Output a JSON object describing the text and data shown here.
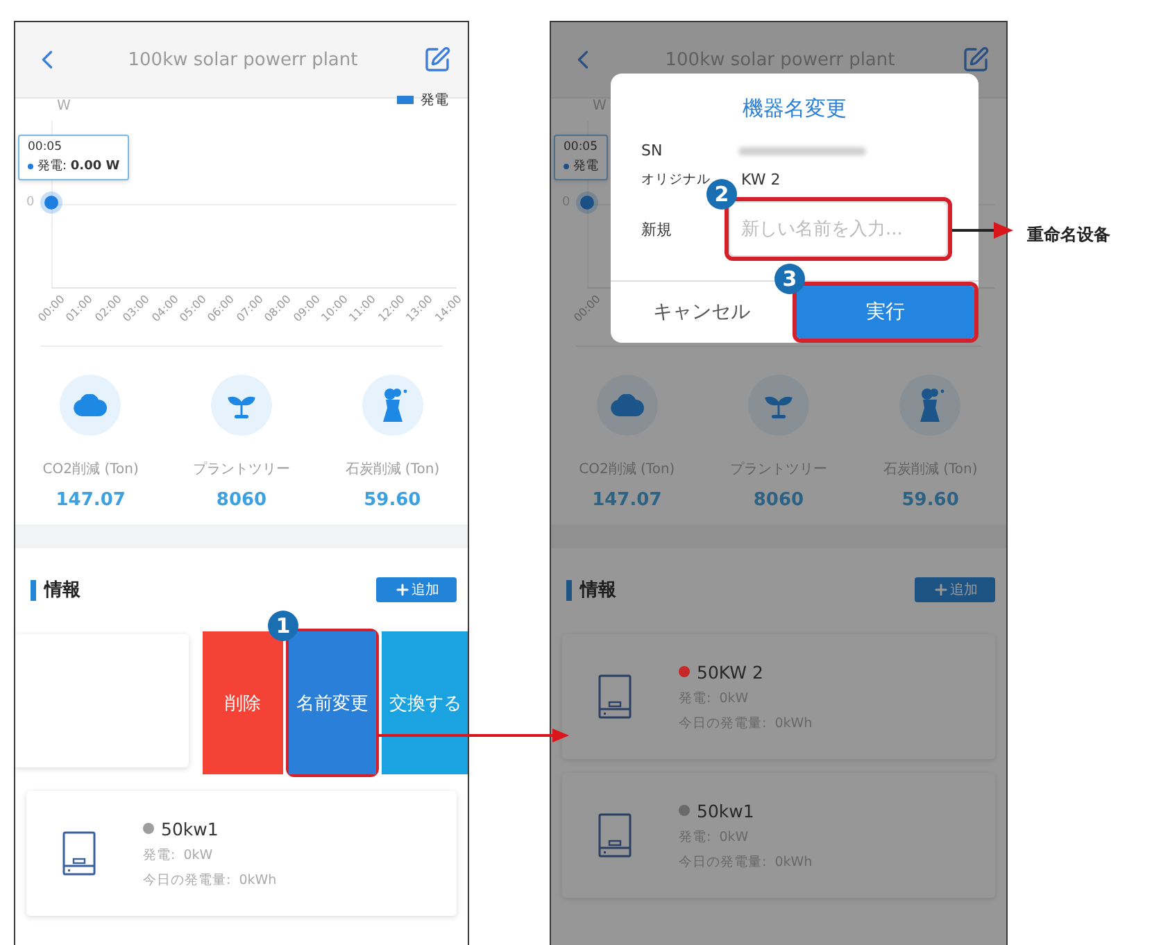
{
  "annotations": {
    "callout": "重命名设备"
  },
  "screens": [
    {
      "dimmed": false,
      "title": "100kw solar powerr plant",
      "chart": {
        "legend": "発電",
        "unit": "W",
        "tooltip": {
          "time": "00:05",
          "text": "発電: **0.00 W**"
        },
        "y_tick": "0",
        "x_ticks": [
          "00:00",
          "01:00",
          "02:00",
          "03:00",
          "04:00",
          "05:00",
          "06:00",
          "07:00",
          "08:00",
          "09:00",
          "10:00",
          "11:00",
          "12:00",
          "13:00",
          "14:00"
        ]
      },
      "stats": [
        {
          "kind": "co2",
          "label": "CO2削減 (Ton)",
          "value": "147.07"
        },
        {
          "kind": "plant",
          "label": "プラントツリー",
          "value": "8060"
        },
        {
          "kind": "tower",
          "label": "石炭削減 (Ton)",
          "value": "59.60"
        }
      ],
      "section": {
        "title": "情報",
        "add_button": "追加"
      },
      "devices": [
        {
          "kind": "swiped",
          "actions": [
            {
              "kind": "delete",
              "label": "削除",
              "highlighted": false
            },
            {
              "kind": "rename",
              "label": "名前変更",
              "highlighted": true,
              "step": "1"
            },
            {
              "kind": "replace",
              "label": "交換する",
              "highlighted": false
            }
          ]
        },
        {
          "kind": "card",
          "name": "50kw1",
          "color": "#9e9e9e",
          "power": "発電:  0kW",
          "energy": "今日の発電量:  0kWh"
        }
      ]
    },
    {
      "dimmed": true,
      "title": "100kw solar powerr plant",
      "chart": {
        "unit": "W",
        "tooltip": {
          "time": "00:05",
          "text": "発電"
        },
        "y_tick": "0",
        "x_ticks": [
          "00:00"
        ]
      },
      "stats": [
        {
          "kind": "co2",
          "label": "CO2削減 (Ton)",
          "value": "147.07"
        },
        {
          "kind": "plant",
          "label": "プラントツリー",
          "value": "8060"
        },
        {
          "kind": "tower",
          "label": "石炭削減 (Ton)",
          "value": "59.60"
        }
      ],
      "section": {
        "title": "情報",
        "add_button": "追加"
      },
      "devices": [
        {
          "kind": "card",
          "name": "50KW 2",
          "color": "#c62828",
          "power": "発電:  0kW",
          "energy": "今日の発電量:  0kWh"
        },
        {
          "kind": "card",
          "name": "50kw1",
          "color": "#6a6a6a",
          "power": "発電:  0kW",
          "energy": "今日の発電量:  0kWh"
        }
      ],
      "dialog": {
        "title": "機器名変更",
        "sn_label": "SN",
        "original_label": "オリジナル",
        "original_value": "KW 2",
        "new_label": "新規",
        "input": {
          "placeholder": "新しい名前を入力...",
          "highlighted": true,
          "step": "2"
        },
        "cancel": "キャンセル",
        "confirm": {
          "label": "実行",
          "highlighted": true,
          "step": "3"
        }
      }
    }
  ]
}
